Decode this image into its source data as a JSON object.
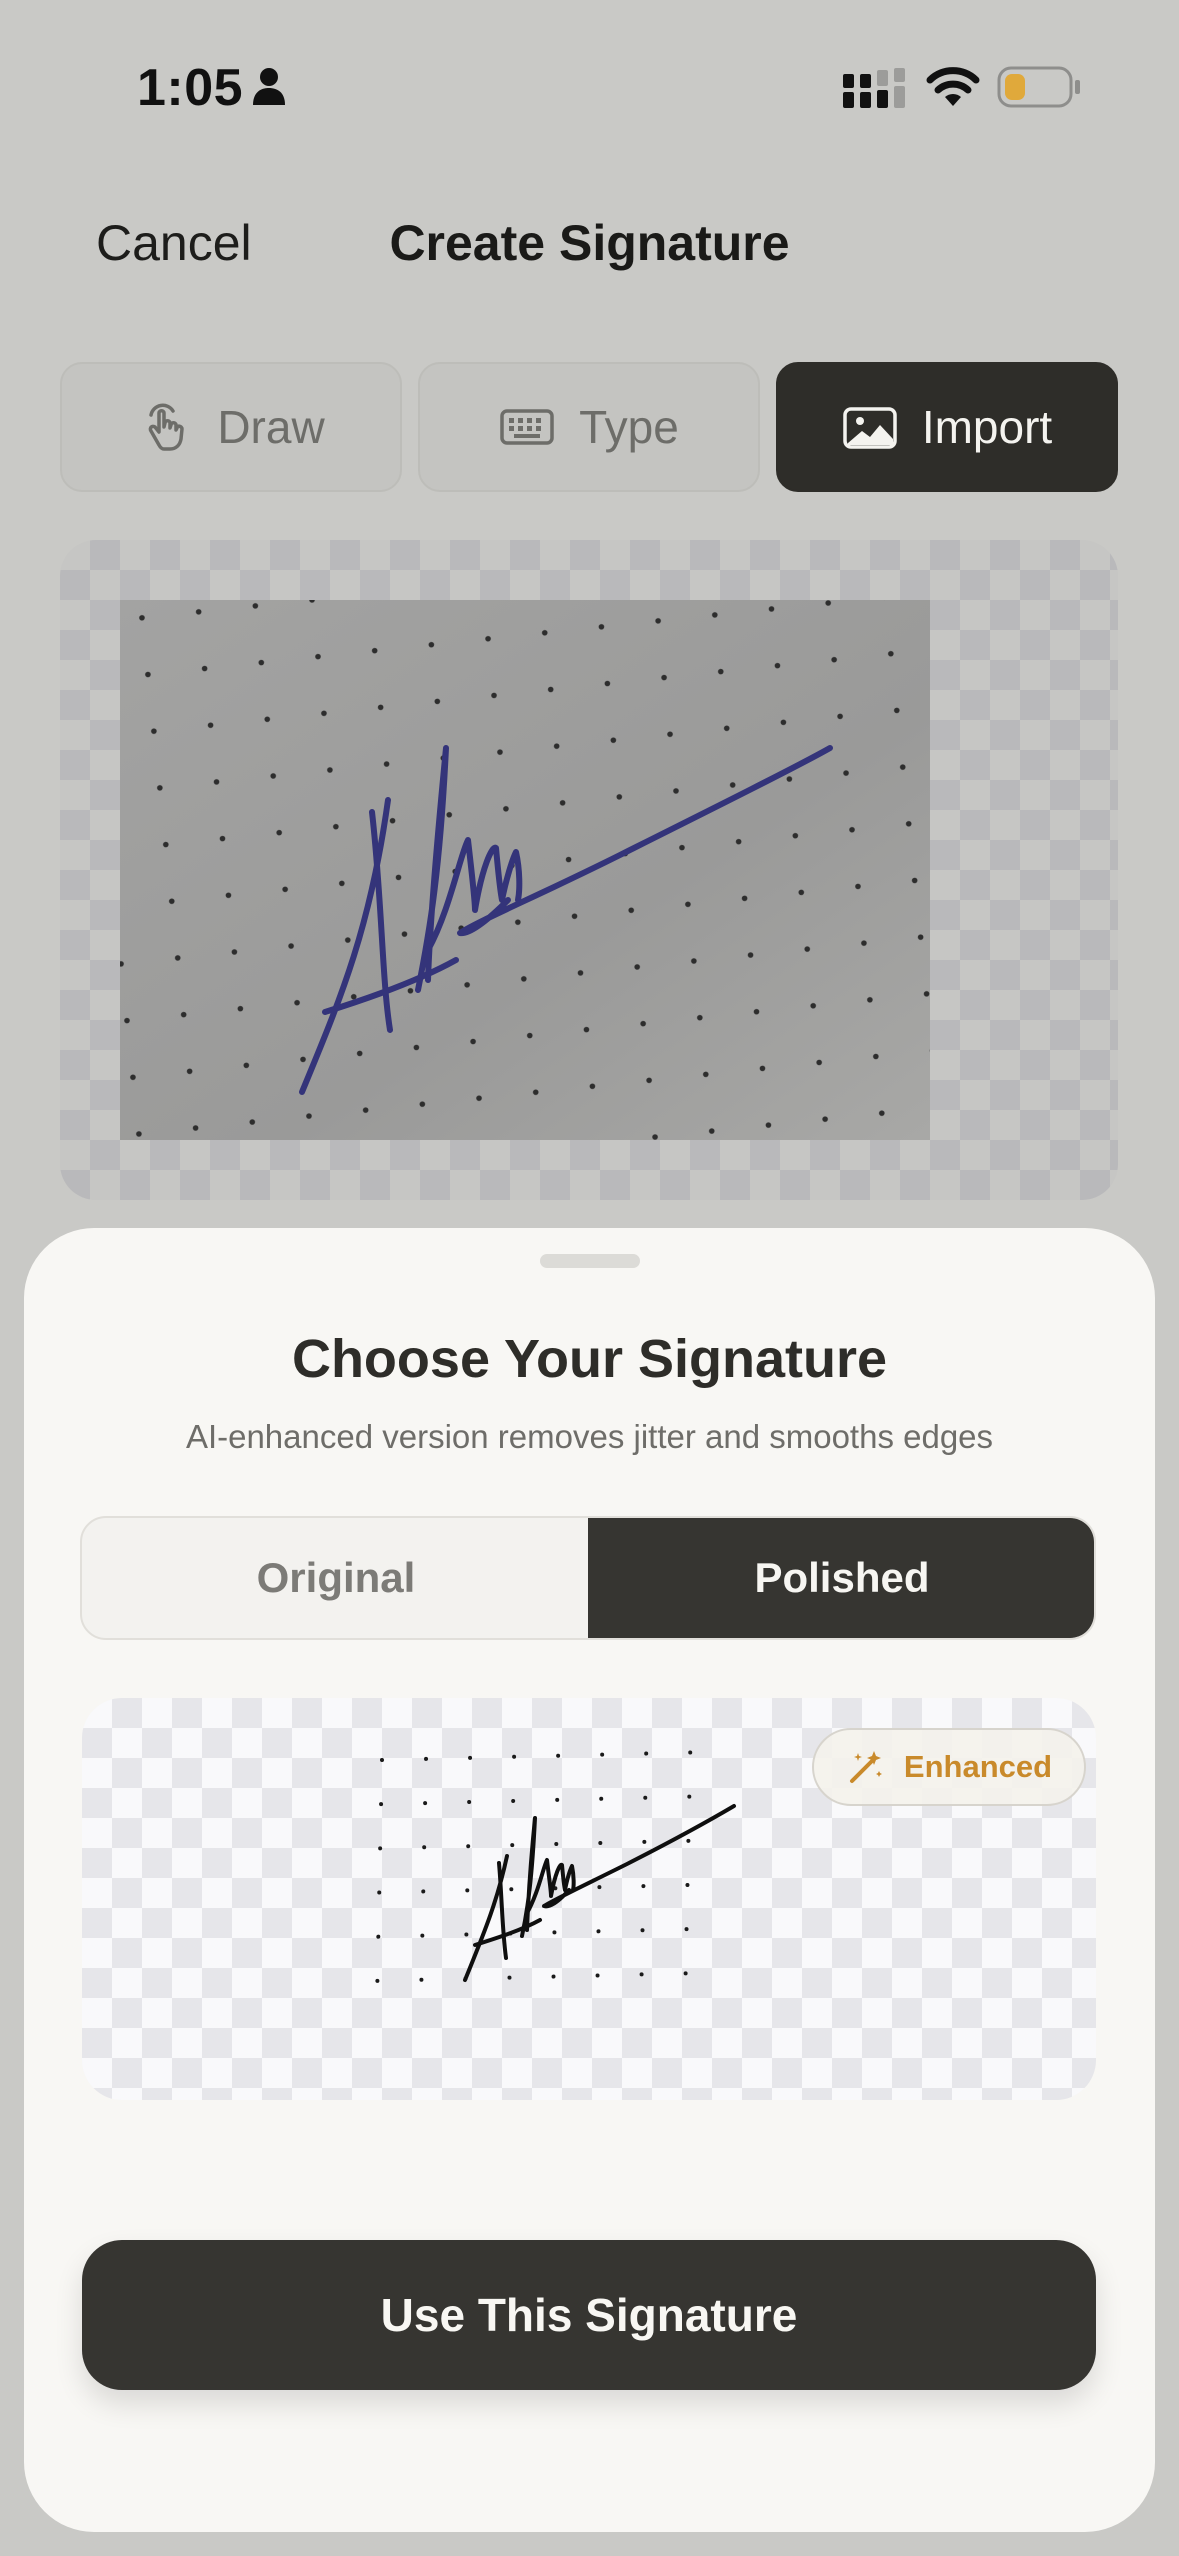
{
  "status_bar": {
    "time": "1:05"
  },
  "nav": {
    "cancel": "Cancel",
    "title": "Create Signature"
  },
  "mode_tabs": [
    {
      "label": "Draw",
      "icon": "hand-pointer-icon",
      "selected": false
    },
    {
      "label": "Type",
      "icon": "keyboard-icon",
      "selected": false
    },
    {
      "label": "Import",
      "icon": "photo-icon",
      "selected": true
    }
  ],
  "sheet": {
    "title": "Choose Your Signature",
    "subtitle": "AI-enhanced version removes jitter and smooths edges",
    "options": {
      "original": "Original",
      "polished": "Polished",
      "selected": "Polished"
    },
    "badge": {
      "label": "Enhanced",
      "icon": "magic-wand-icon"
    },
    "primary_button": "Use This Signature"
  },
  "colors": {
    "accent_dark": "#363531",
    "badge_text": "#c98a2b",
    "ink_blue": "#34347a",
    "battery_fill": "#e0a93b"
  }
}
